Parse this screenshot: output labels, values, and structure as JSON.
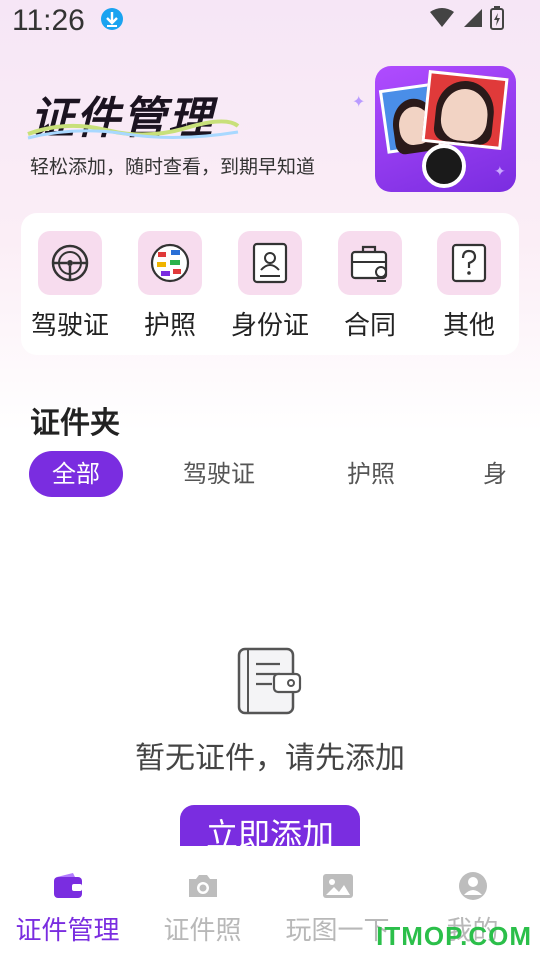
{
  "status_bar": {
    "time": "11:26"
  },
  "header": {
    "title": "证件管理",
    "subtitle": "轻松添加，随时查看，到期早知道"
  },
  "categories": [
    {
      "label": "驾驶证",
      "icon": "steering-wheel-icon"
    },
    {
      "label": "护照",
      "icon": "globe-flags-icon"
    },
    {
      "label": "身份证",
      "icon": "id-card-icon"
    },
    {
      "label": "合同",
      "icon": "briefcase-stamp-icon"
    },
    {
      "label": "其他",
      "icon": "question-mark-icon"
    }
  ],
  "folder": {
    "title": "证件夹",
    "tabs": [
      "全部",
      "驾驶证",
      "护照",
      "身"
    ]
  },
  "empty_state": {
    "message": "暂无证件，请先添加",
    "button_label": "立即添加"
  },
  "bottom_nav": [
    {
      "label": "证件管理",
      "icon": "wallet-icon",
      "active": true
    },
    {
      "label": "证件照",
      "icon": "camera-icon",
      "active": false
    },
    {
      "label": "玩图一下",
      "icon": "image-icon",
      "active": false
    },
    {
      "label": "我的",
      "icon": "user-icon",
      "active": false
    }
  ],
  "watermark": "ITMOP.COM",
  "colors": {
    "accent": "#7a2de0",
    "inactive": "#b8b8b8",
    "icon_bg": "#f7dcee"
  }
}
